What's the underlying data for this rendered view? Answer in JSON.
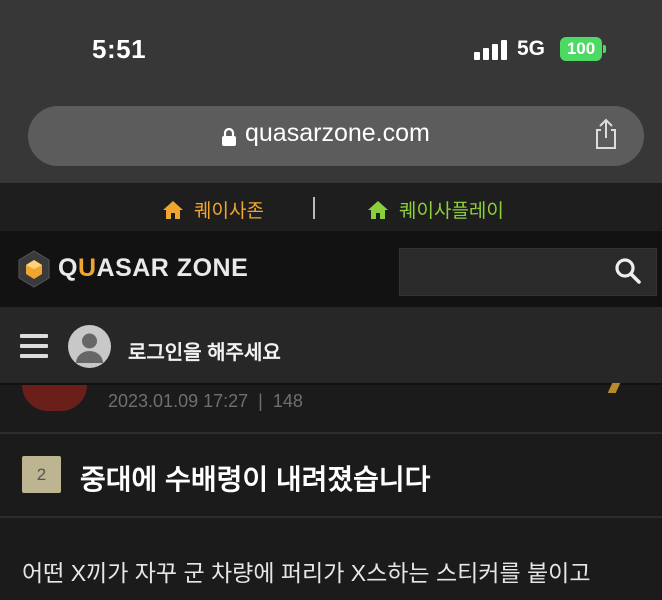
{
  "status_bar": {
    "time": "5:51",
    "network": "5G",
    "battery": "100"
  },
  "browser": {
    "url": "quasarzone.com"
  },
  "top_links": {
    "quasarzone": "퀘이사존",
    "quasarplay": "퀘이사플레이"
  },
  "header": {
    "logo_prefix": "Q",
    "logo_accent": "U",
    "logo_rest": "ASAR ZONE"
  },
  "nav": {
    "login": "로그인을 해주세요"
  },
  "previous_post": {
    "date": "2023.01.09 17:27",
    "separator": "|",
    "views": "148"
  },
  "post": {
    "rank": "2",
    "title": "중대에 수배령이 내려졌습니다",
    "body": "어떤 X끼가 자꾸 군 차량에 퍼리가 X스하는 스티커를 붙이고"
  },
  "colors": {
    "accent_orange": "#f0a530",
    "accent_green": "#8ccf3c",
    "battery_green": "#4cd964"
  }
}
